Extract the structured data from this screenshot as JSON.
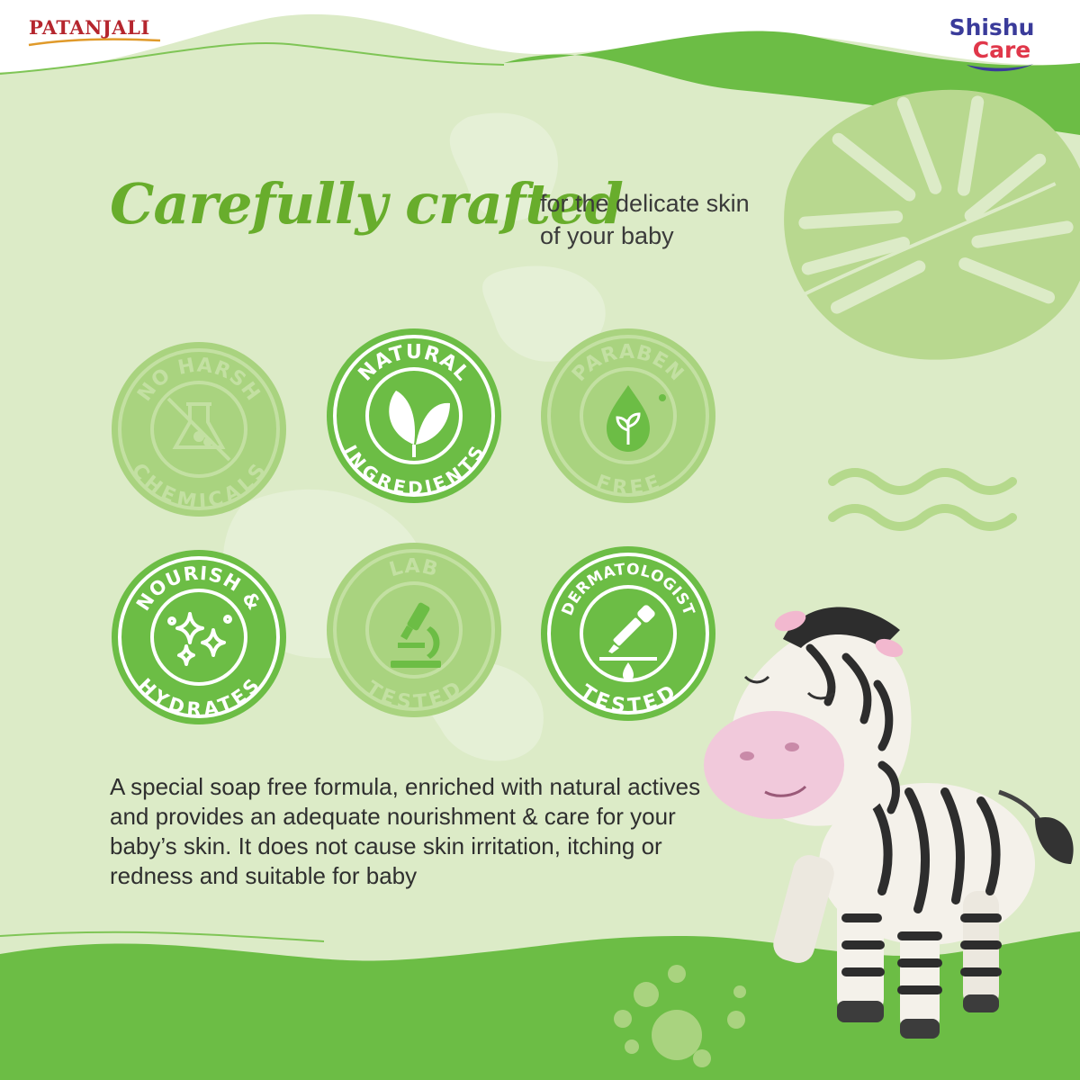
{
  "brand": {
    "name": "PATANJALI",
    "sub_brand_line1": "Shishu",
    "sub_brand_line2": "Care"
  },
  "headline": {
    "title": "Carefully crafted",
    "subtitle_line1": "for the delicate skin",
    "subtitle_line2": "of your baby"
  },
  "badges": [
    {
      "top": "NO HARSH",
      "bottom": "CHEMICALS",
      "icon": "no-flask-icon",
      "style": "light"
    },
    {
      "top": "NATURAL",
      "bottom": "INGREDIENTS",
      "icon": "leaf-icon",
      "style": "dark"
    },
    {
      "top": "PARABEN",
      "bottom": "FREE",
      "icon": "drop-leaf-icon",
      "style": "light"
    },
    {
      "top": "NOURISH &",
      "bottom": "HYDRATES",
      "icon": "sparkle-icon",
      "style": "dark"
    },
    {
      "top": "LAB",
      "bottom": "TESTED",
      "icon": "microscope-icon",
      "style": "light"
    },
    {
      "top": "DERMATOLOGIST",
      "bottom": "TESTED",
      "icon": "dropper-icon",
      "style": "dark"
    }
  ],
  "description": "A special soap free formula, enriched with natural actives and provides an adequate nourishment & care for your baby’s skin. It does not cause skin irritation, itching or redness and suitable for baby",
  "colors": {
    "background": "#dcebc7",
    "accent_green": "#6cbd45",
    "light_badge": "#a9d37f",
    "brand_red": "#b5262e",
    "shishu_blue": "#3a3b9a",
    "shishu_red": "#e0374a"
  }
}
